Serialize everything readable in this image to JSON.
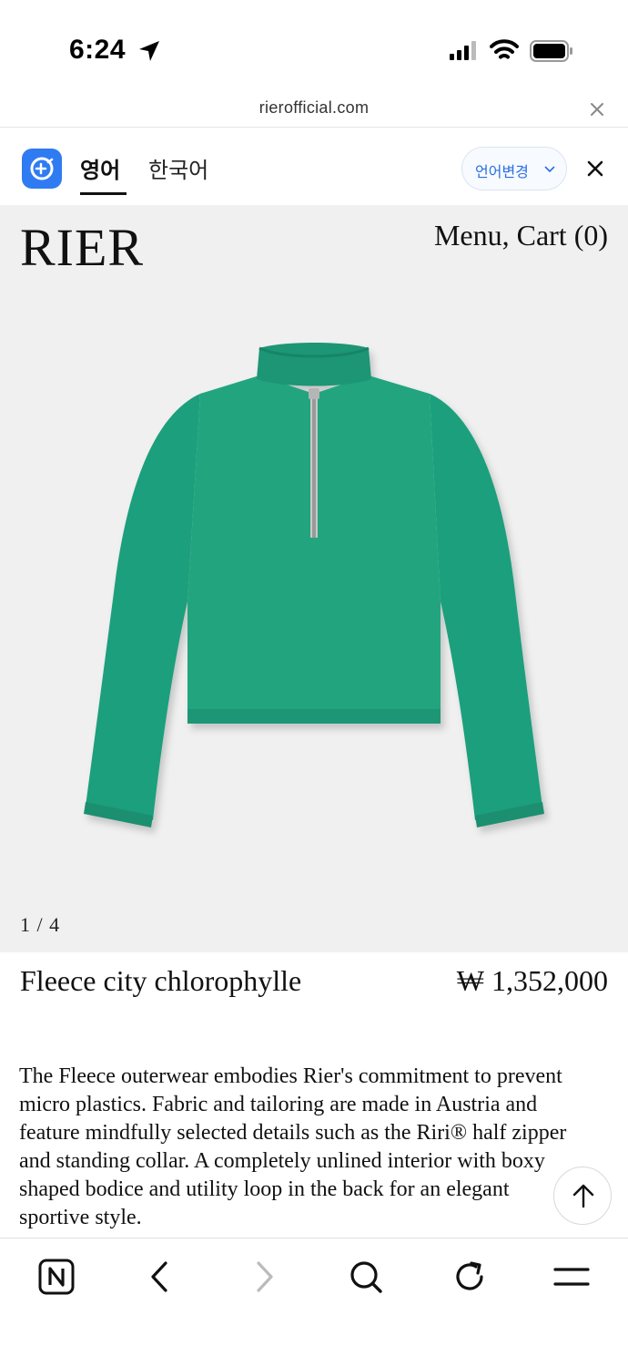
{
  "status_bar": {
    "time": "6:24",
    "icons": [
      "location-arrow-icon",
      "cellular-signal-icon",
      "wifi-icon",
      "battery-icon"
    ]
  },
  "browser": {
    "url": "rierofficial.com",
    "close_icon": "close-icon"
  },
  "translate_bar": {
    "tabs": [
      {
        "label": "영어",
        "active": true
      },
      {
        "label": "한국어",
        "active": false
      }
    ],
    "change_language_label": "언어변경",
    "accent_color": "#2f7bf2"
  },
  "site_header": {
    "logo": "RIER",
    "nav_label": "Menu, Cart (0)"
  },
  "product": {
    "image_counter": "1 / 4",
    "name": "Fleece city chlorophylle",
    "price": "₩ 1,352,000",
    "description": "The Fleece outerwear embodies Rier's commitment to prevent micro plastics. Fabric and tailoring are made in Austria and feature mindfully selected details such as the Riri® half zipper and standing collar. A completely unlined interior with boxy shaped bodice and utility loop in the back for an elegant sportive style.",
    "garment_color": "#20a07c"
  },
  "toolbar": {
    "icons": [
      "naver-home-icon",
      "back-arrow-icon",
      "forward-arrow-icon",
      "search-icon",
      "refresh-icon",
      "menu-icon"
    ]
  }
}
